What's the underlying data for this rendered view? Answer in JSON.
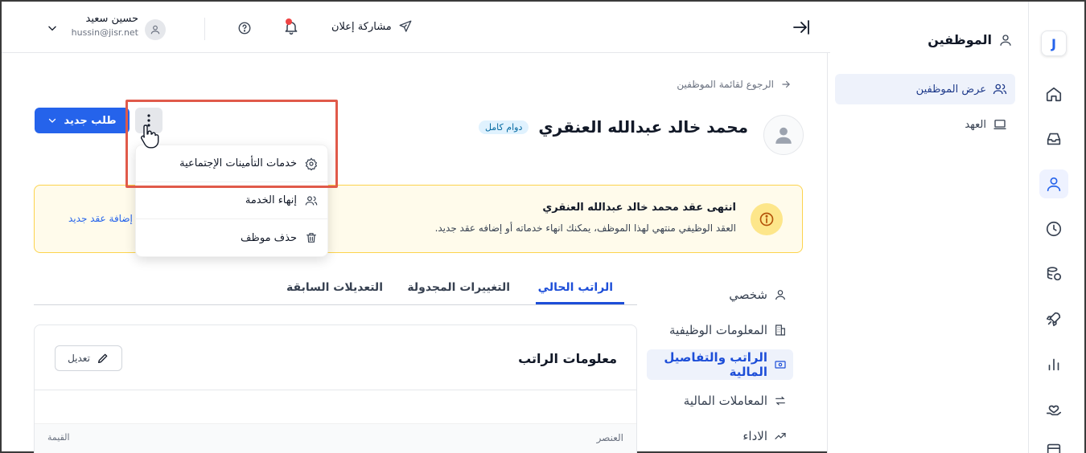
{
  "rail": {
    "logo": "J",
    "icons": [
      "home-icon",
      "inbox-icon",
      "user-icon",
      "clock-icon",
      "coins-icon",
      "rocket-icon",
      "chart-icon",
      "hand-heart-icon",
      "calendar-icon"
    ]
  },
  "sidebar": {
    "title": "الموظفين",
    "items": [
      {
        "label": "عرض الموظفين"
      },
      {
        "label": "العهد"
      }
    ]
  },
  "topbar": {
    "user_name": "حسين سعيد",
    "user_email": "hussin@jisr.net",
    "share_label": "مشاركة إعلان"
  },
  "breadcrumb": {
    "back_label": "الرجوع لقائمة الموظفين"
  },
  "employee": {
    "name": "محمد خالد عبدالله العنقري",
    "tag": "دوام كامل"
  },
  "actions": {
    "new_request_label": "طلب جديد"
  },
  "menu": {
    "items": [
      {
        "label": "خدمات التأمينات الإجتماعية"
      },
      {
        "label": "إنهاء الخدمة"
      },
      {
        "label": "حذف موظف"
      }
    ]
  },
  "alert": {
    "title": "انتهى عقد محمد خالد عبدالله العنقري",
    "body": "العقد الوظيفي منتهي لهذا الموظف، يمكنك انهاء خدماته أو إضافه عقد جديد.",
    "link": "إضافة عقد جديد"
  },
  "subnav": {
    "items": [
      {
        "label": "شخصي"
      },
      {
        "label": "المعلومات الوظيفية"
      },
      {
        "label": "الراتب والتفاصيل المالية"
      },
      {
        "label": "المعاملات المالية"
      },
      {
        "label": "الاداء"
      }
    ]
  },
  "tabs": [
    {
      "label": "الراتب الحالي"
    },
    {
      "label": "التغييرات المجدولة"
    },
    {
      "label": "التعديلات السابقة"
    }
  ],
  "card": {
    "title": "معلومات الراتب",
    "edit_label": "تعديل",
    "col_item": "العنصر",
    "col_value": "القيمة"
  },
  "colors": {
    "primary": "#2563eb",
    "alert_bg": "#fffbeb",
    "highlight": "#e05a4a"
  }
}
